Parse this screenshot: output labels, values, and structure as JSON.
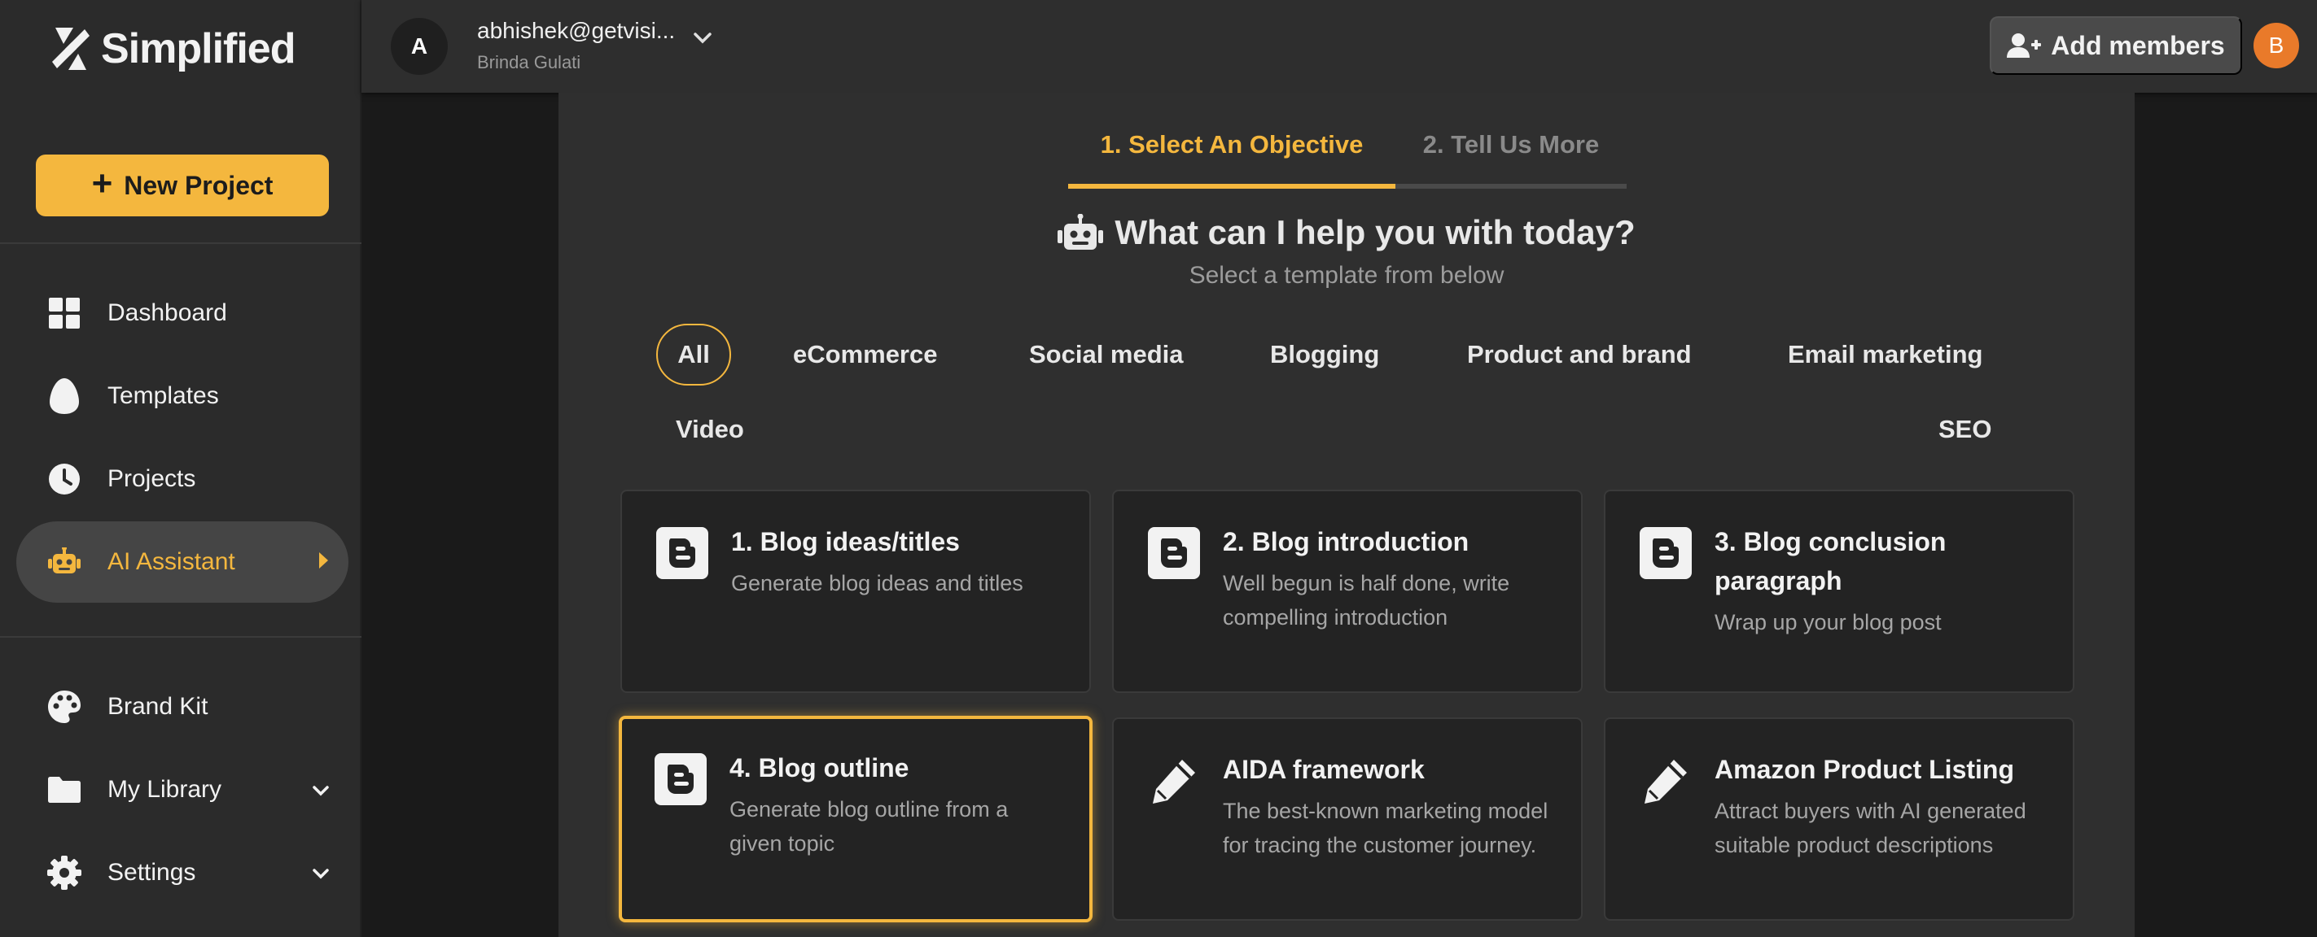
{
  "app": {
    "logo_text": "Simplified"
  },
  "sidebar": {
    "new_project_label": "New Project",
    "items": [
      {
        "label": "Dashboard"
      },
      {
        "label": "Templates"
      },
      {
        "label": "Projects"
      },
      {
        "label": "AI Assistant"
      },
      {
        "label": "Brand Kit"
      },
      {
        "label": "My Library"
      },
      {
        "label": "Settings"
      }
    ]
  },
  "topbar": {
    "avatar_initial": "A",
    "account_email": "abhishek@getvisi...",
    "account_name": "Brinda Gulati",
    "add_members_label": "Add members",
    "user_initial": "B"
  },
  "wizard": {
    "steps": [
      {
        "label": "1. Select An Objective"
      },
      {
        "label": "2. Tell Us More"
      }
    ],
    "heading": "What can I help you with today?",
    "subheading": "Select a template from below"
  },
  "categories": [
    {
      "label": "All"
    },
    {
      "label": "eCommerce"
    },
    {
      "label": "Social media"
    },
    {
      "label": "Blogging"
    },
    {
      "label": "Product and brand"
    },
    {
      "label": "Email marketing"
    },
    {
      "label": "Video"
    },
    {
      "label": "SEO"
    }
  ],
  "templates": [
    {
      "title": "1. Blog ideas/titles",
      "description": "Generate blog ideas and titles",
      "icon": "blogger-icon"
    },
    {
      "title": "2. Blog introduction",
      "description": "Well begun is half done, write compelling introduction",
      "icon": "blogger-icon"
    },
    {
      "title": "3. Blog conclusion paragraph",
      "description": "Wrap up your blog post",
      "icon": "blogger-icon"
    },
    {
      "title": "4. Blog outline",
      "description": "Generate blog outline from a given topic",
      "icon": "blogger-icon"
    },
    {
      "title": "AIDA framework",
      "description": "The best-known marketing model for tracing the customer journey.",
      "icon": "pencil-icon"
    },
    {
      "title": "Amazon Product Listing",
      "description": "Attract buyers with AI generated suitable product descriptions",
      "icon": "pencil-icon"
    }
  ],
  "colors": {
    "accent": "#f4b73e",
    "user_avatar": "#e97a2a",
    "sidebar_bg": "#2b2b2b",
    "card_bg": "#232323"
  }
}
